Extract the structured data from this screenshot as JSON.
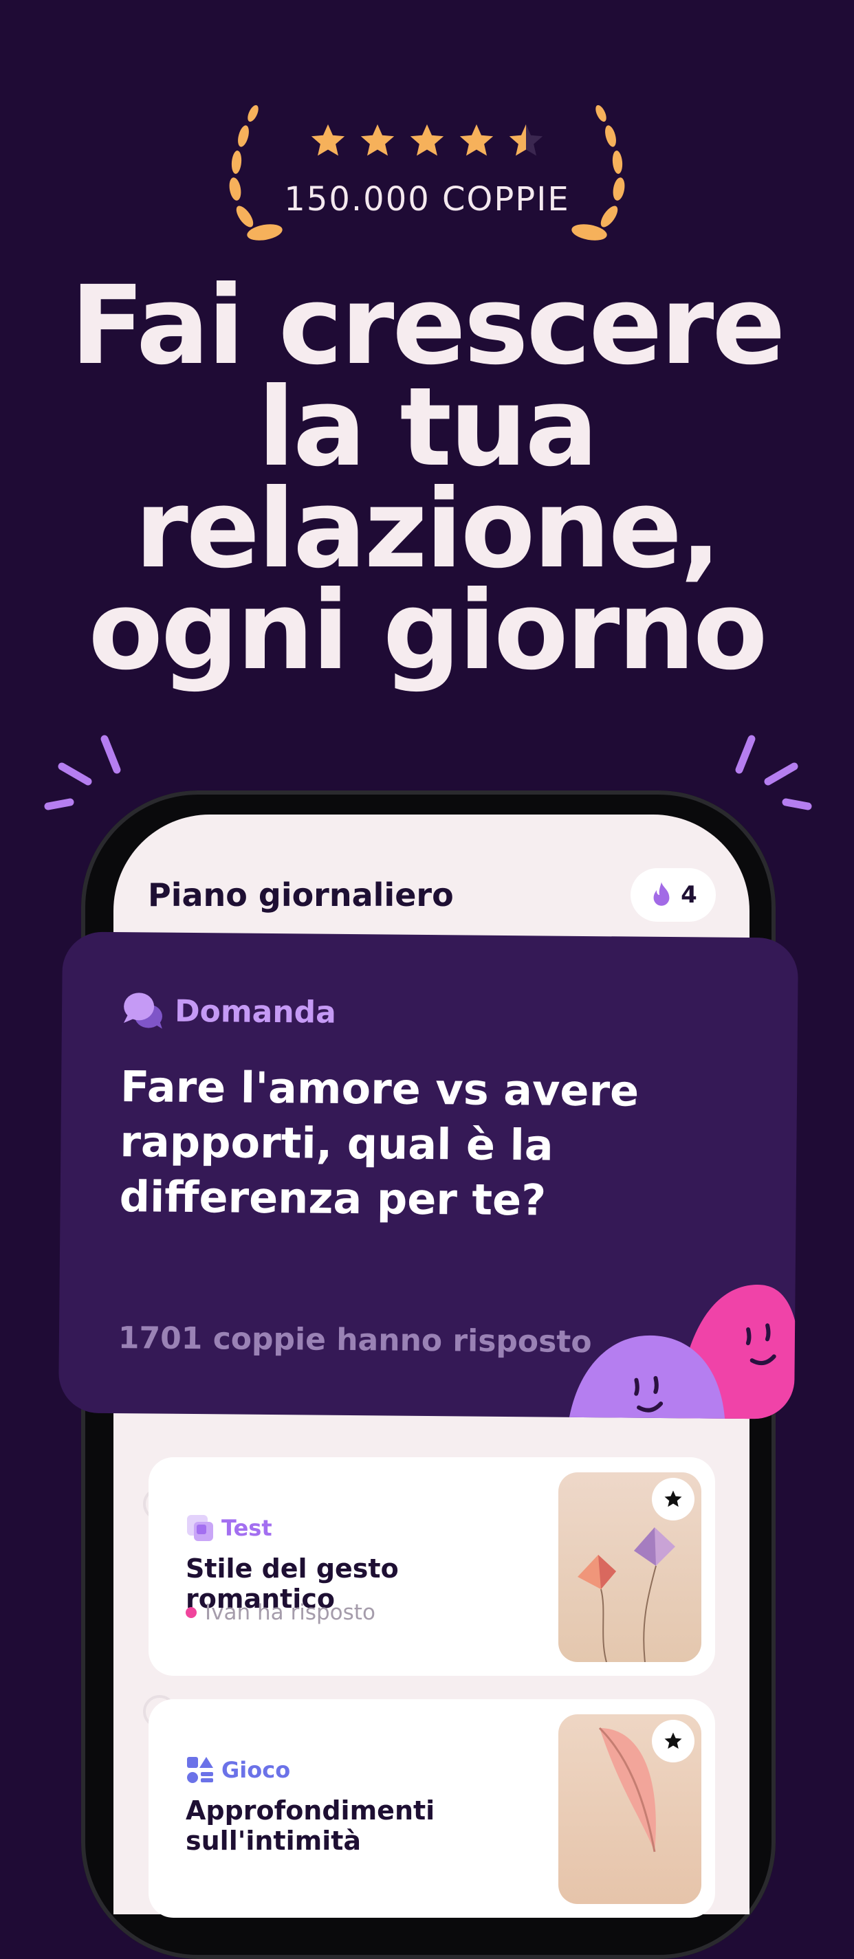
{
  "rating": {
    "stars": 4.5,
    "couples_label": "150.000 COPPIE",
    "star_color": "#f6b15b"
  },
  "headline": {
    "lines": [
      "Fai crescere",
      "la tua",
      "relazione,",
      "ogni giorno"
    ]
  },
  "app": {
    "plan_title": "Piano giornaliero",
    "streak_count": "4",
    "question_card": {
      "type_label": "Domanda",
      "question": "Fare l'amore vs avere rapporti, qual è la differenza per te?",
      "footer": "1701 coppie hanno risposto"
    },
    "cards": [
      {
        "type_label": "Test",
        "type_color": "#a36ff0",
        "title": "Stile del gesto romantico",
        "subtitle": "Ivan ha risposto"
      },
      {
        "type_label": "Gioco",
        "type_color": "#6b72e8",
        "title": "Approfondimenti sull'intimità",
        "subtitle": ""
      }
    ]
  },
  "colors": {
    "background": "#1f0b35",
    "card_purple": "#351956",
    "accent_pink": "#f0449c",
    "accent_lilac": "#b57ef0"
  }
}
